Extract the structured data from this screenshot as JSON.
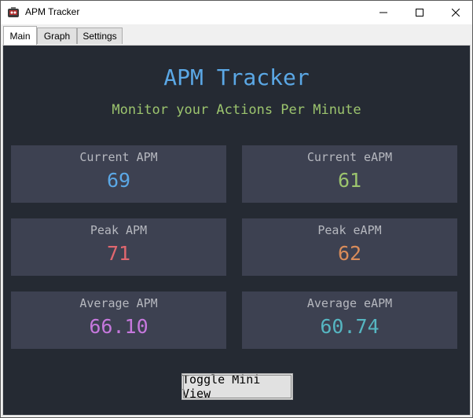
{
  "window": {
    "title": "APM Tracker"
  },
  "tabs": [
    {
      "label": "Main",
      "active": true
    },
    {
      "label": "Graph",
      "active": false
    },
    {
      "label": "Settings",
      "active": false
    }
  ],
  "main": {
    "heading": "APM Tracker",
    "subheading": "Monitor your Actions Per Minute",
    "stats": [
      {
        "label": "Current APM",
        "value": "69",
        "color": "#5ba8e6"
      },
      {
        "label": "Current eAPM",
        "value": "61",
        "color": "#9cc46e"
      },
      {
        "label": "Peak APM",
        "value": "71",
        "color": "#e0676f"
      },
      {
        "label": "Peak eAPM",
        "value": "62",
        "color": "#d98c5a"
      },
      {
        "label": "Average APM",
        "value": "66.10",
        "color": "#c678dd"
      },
      {
        "label": "Average eAPM",
        "value": "60.74",
        "color": "#56b6c2"
      }
    ],
    "toggle_label": "Toggle Mini View"
  },
  "colors": {
    "background": "#252a33",
    "card": "#3d4151",
    "accent": "#5ba8e6",
    "sub": "#9cc46e"
  },
  "icons": {
    "app": "app-icon",
    "minimize": "minimize-icon",
    "maximize": "maximize-icon",
    "close": "close-icon"
  }
}
